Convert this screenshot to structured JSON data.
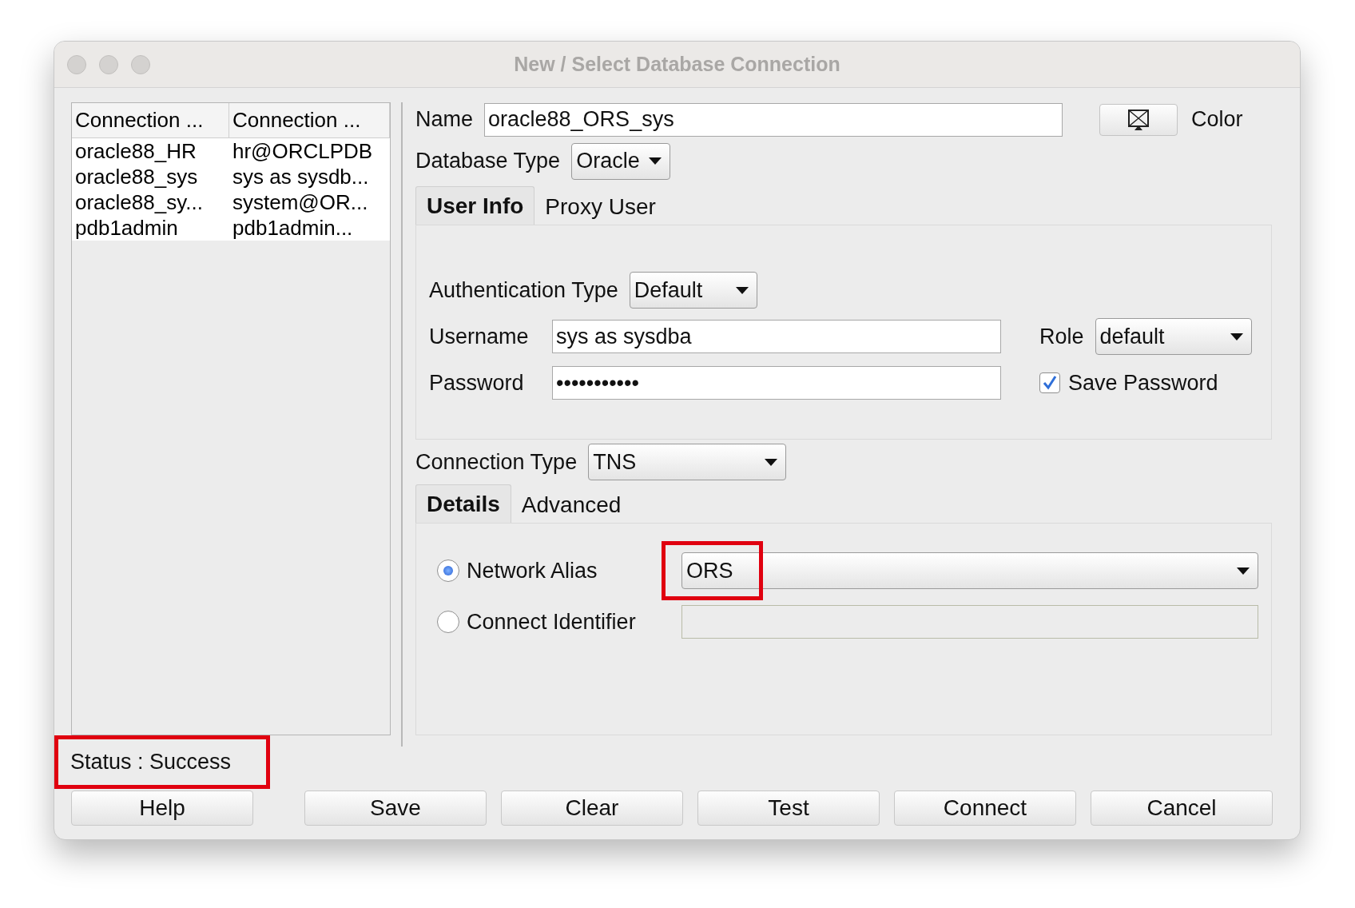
{
  "window": {
    "title": "New / Select Database Connection"
  },
  "connections": {
    "columns": [
      "Connection ...",
      "Connection ..."
    ],
    "rows": [
      {
        "cells": [
          "oracle88_HR",
          "hr@ORCLPDB"
        ]
      },
      {
        "cells": [
          "oracle88_sys",
          "sys as sysdb..."
        ]
      },
      {
        "cells": [
          "oracle88_sy...",
          "system@OR..."
        ]
      },
      {
        "cells": [
          "pdb1admin",
          "pdb1admin..."
        ]
      }
    ]
  },
  "name": {
    "label": "Name",
    "value": "oracle88_ORS_sys"
  },
  "color_button": {
    "label": "Color"
  },
  "database_type": {
    "label": "Database Type",
    "value": "Oracle"
  },
  "user_tabs": [
    {
      "label": "User Info",
      "selected": true
    },
    {
      "label": "Proxy User",
      "selected": false
    }
  ],
  "authentication_type": {
    "label": "Authentication Type",
    "value": "Default"
  },
  "username": {
    "label": "Username",
    "value": "sys as sysdba"
  },
  "password": {
    "label": "Password",
    "value": "•••••••••••"
  },
  "role": {
    "label": "Role",
    "value": "default"
  },
  "save_password": {
    "label": "Save Password",
    "checked": true
  },
  "connection_type": {
    "label": "Connection Type",
    "value": "TNS"
  },
  "detail_tabs": [
    {
      "label": "Details",
      "selected": true
    },
    {
      "label": "Advanced",
      "selected": false
    }
  ],
  "connect_options": [
    {
      "label": "Network Alias",
      "selected": true,
      "kind": "dropdown",
      "value": "ORS",
      "highlighted": true
    },
    {
      "label": "Connect Identifier",
      "selected": false,
      "kind": "text",
      "highlighted": false
    }
  ],
  "status": {
    "text": "Status : Success",
    "highlighted": true
  },
  "buttons": [
    "Help",
    "Save",
    "Clear",
    "Test",
    "Connect",
    "Cancel"
  ]
}
